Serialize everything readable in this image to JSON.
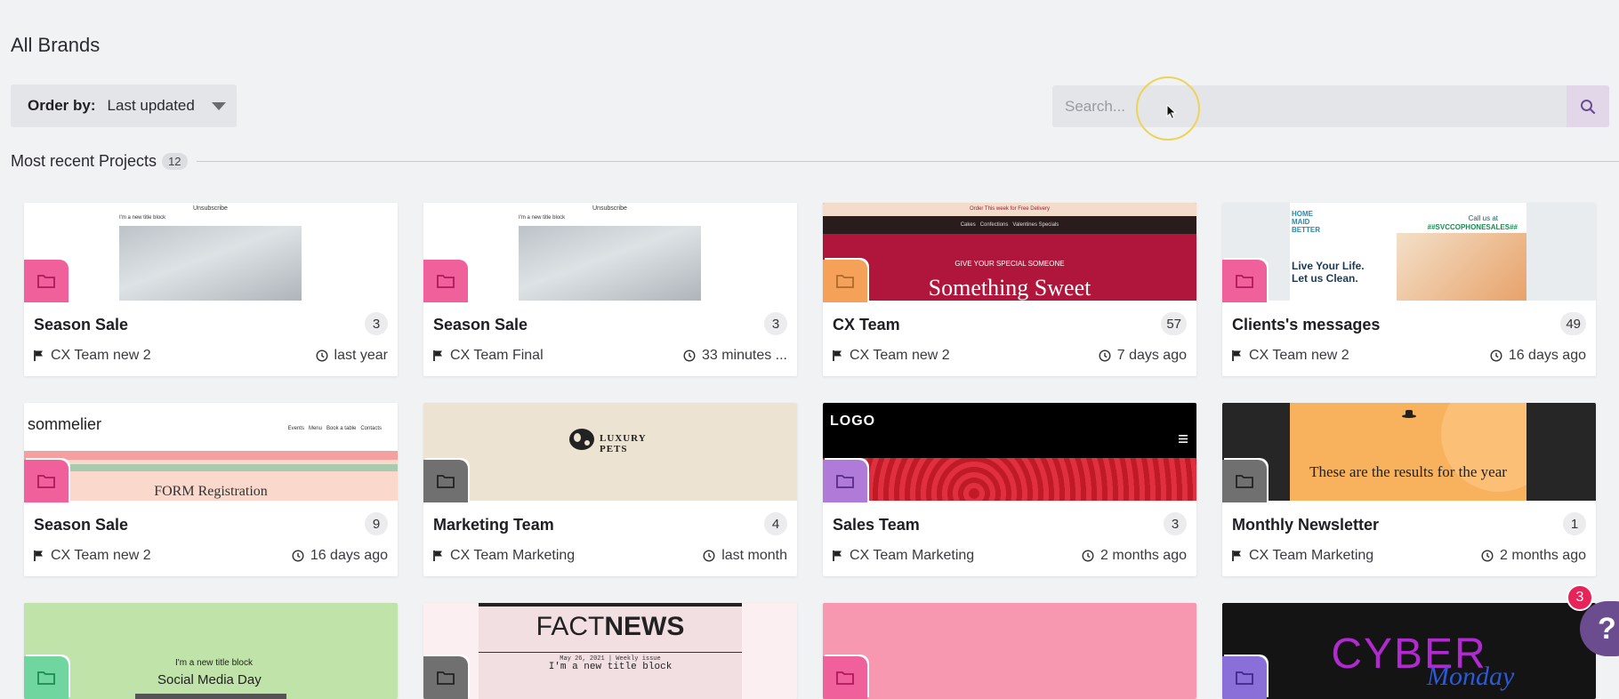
{
  "page": {
    "title": "All Brands"
  },
  "order": {
    "label": "Order by:",
    "value": "Last updated"
  },
  "search": {
    "placeholder": "Search..."
  },
  "section": {
    "title": "Most recent Projects",
    "count": "12"
  },
  "thumb_text": {
    "unsubscribe": "Unsubscribe",
    "new_title_block": "I'm a new title block",
    "order_delivery": "Order This week for Free Delivery",
    "nav_cakes": "Cakes   Confections   Valentines Specials",
    "give_special": "GIVE YOUR SPECIAL SOMEONE",
    "something_sweet": "Something Sweet",
    "home_maid": "HOME MAID BETTER",
    "call_us": "Call us at",
    "phone_tag": "##SVCCOPHONESALES##",
    "live_life": "Live Your Life. Let us Clean.",
    "sommelier": "sommelier",
    "som_nav": "Events   Menu   Book a table   Contacts",
    "form_reg": "FORM Registration",
    "luxury_pets": "LUXURY PETS",
    "logo": "LOGO",
    "results": "These are the results for the year",
    "social_media_day": "Social Media Day",
    "factnews_fact": "FACT",
    "factnews_news": "NEWS",
    "factnews_date": "May 26, 2021  |  Weekly issue",
    "cyber": "CYBER",
    "monday": "Monday"
  },
  "projects": [
    {
      "title": "Season Sale",
      "count": "3",
      "team": "CX Team new 2",
      "time": "last year"
    },
    {
      "title": "Season Sale",
      "count": "3",
      "team": "CX Team Final",
      "time": "33 minutes ..."
    },
    {
      "title": "CX Team",
      "count": "57",
      "team": "CX Team new 2",
      "time": "7 days ago"
    },
    {
      "title": "Clients's messages",
      "count": "49",
      "team": "CX Team new 2",
      "time": "16 days ago"
    },
    {
      "title": "Season Sale",
      "count": "9",
      "team": "CX Team new 2",
      "time": "16 days ago"
    },
    {
      "title": "Marketing Team",
      "count": "4",
      "team": "CX Team Marketing",
      "time": "last month"
    },
    {
      "title": "Sales Team",
      "count": "3",
      "team": "CX Team Marketing",
      "time": "2 months ago"
    },
    {
      "title": "Monthly Newsletter",
      "count": "1",
      "team": "CX Team Marketing",
      "time": "2 months ago"
    }
  ],
  "folder_colors": [
    "#f0609a",
    "#f0609a",
    "#f5a15a",
    "#f0609a",
    "#f0609a",
    "#707070",
    "#b07ad8",
    "#707070",
    "#6fd6a0",
    "#707070",
    "#f0609a",
    "#8a6fd8"
  ],
  "help": {
    "badge": "3",
    "label": "?"
  }
}
